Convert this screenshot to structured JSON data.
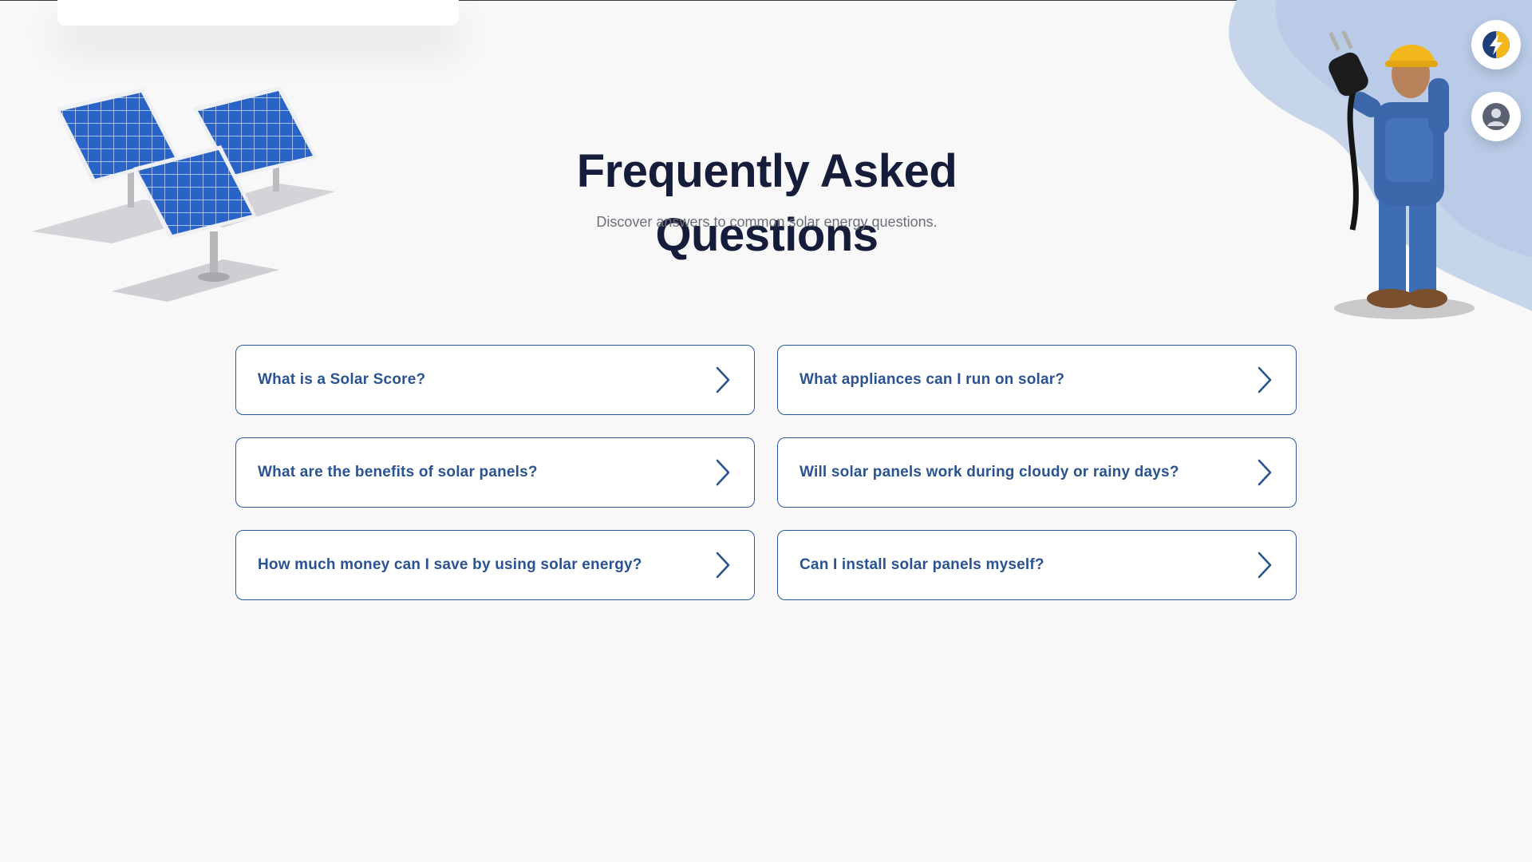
{
  "faq": {
    "title": "Frequently Asked Questions",
    "subtitle": "Discover answers to common solar energy questions.",
    "items": [
      {
        "question": "What is a Solar Score?"
      },
      {
        "question": "What appliances can I run on solar?"
      },
      {
        "question": "What are the benefits of solar panels?"
      },
      {
        "question": "Will solar panels work during cloudy or rainy days?"
      },
      {
        "question": "How much money can I save by using solar energy?"
      },
      {
        "question": "Can I install solar panels myself?"
      }
    ]
  },
  "side_actions": [
    {
      "icon": "lightning-bolt-icon"
    },
    {
      "icon": "user-avatar-icon"
    }
  ],
  "illustrations": {
    "left": "solar-panels-illustration",
    "right": "worker-holding-plug-illustration"
  },
  "colors": {
    "title": "#161d3a",
    "subtitle": "#6b6f78",
    "accent_blue": "#2b5390",
    "card_border": "#2d5a9a",
    "background": "#f8f8f9",
    "blob": "#c6d5ea"
  }
}
